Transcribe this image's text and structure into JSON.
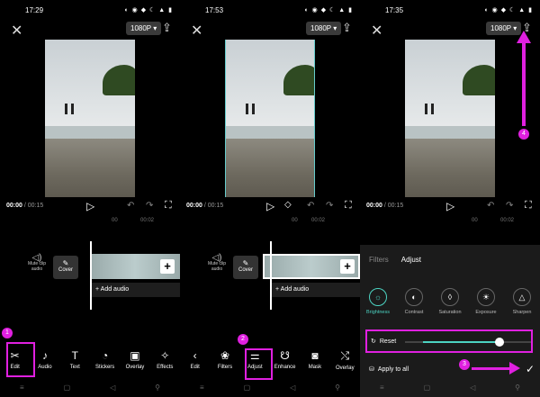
{
  "screens": [
    {
      "time": "17:29",
      "res": "1080P",
      "current": "00:00",
      "total": "00:15",
      "ruler": [
        "00",
        "00:02"
      ],
      "mute_label": "Mute clip audio",
      "cover_label": "Cover",
      "add_audio": "Add audio",
      "tools": [
        {
          "label": "Edit",
          "icon": "scissors-icon",
          "g": "✂"
        },
        {
          "label": "Audio",
          "icon": "music-note-icon",
          "g": "♪"
        },
        {
          "label": "Text",
          "icon": "text-icon",
          "g": "T"
        },
        {
          "label": "Stickers",
          "icon": "sticker-icon",
          "g": "◔"
        },
        {
          "label": "Overlay",
          "icon": "overlay-icon",
          "g": "▣"
        },
        {
          "label": "Effects",
          "icon": "sparkle-icon",
          "g": "✧"
        }
      ],
      "badge": "1"
    },
    {
      "time": "17:53",
      "res": "1080P",
      "current": "00:00",
      "total": "00:15",
      "ruler": [
        "00",
        "00:02"
      ],
      "mute_label": "Mute clip audio",
      "cover_label": "Cover",
      "add_audio": "Add audio",
      "tools": [
        {
          "label": "Edit",
          "icon": "back-chevron-icon",
          "g": "‹"
        },
        {
          "label": "Filters",
          "icon": "filters-icon",
          "g": "❀"
        },
        {
          "label": "Adjust",
          "icon": "sliders-icon",
          "g": "⚌"
        },
        {
          "label": "Enhance",
          "icon": "enhance-icon",
          "g": "☋"
        },
        {
          "label": "Mask",
          "icon": "mask-icon",
          "g": "◙"
        },
        {
          "label": "Overlay",
          "icon": "overlay-icon",
          "g": "⤭"
        }
      ],
      "badge": "2"
    },
    {
      "time": "17:35",
      "res": "1080P",
      "current": "00:00",
      "total": "00:15",
      "ruler": [
        "00",
        "00:02"
      ],
      "tabs": [
        "Filters",
        "Adjust"
      ],
      "adjust": [
        {
          "label": "Brightness",
          "g": "☼",
          "selected": true
        },
        {
          "label": "Contrast",
          "g": "◐"
        },
        {
          "label": "Saturation",
          "g": "◊"
        },
        {
          "label": "Exposure",
          "g": "☀"
        },
        {
          "label": "Sharpen",
          "g": "△"
        }
      ],
      "reset": "Reset",
      "slider_value_fraction": 0.85,
      "apply_all": "Apply to all",
      "badges": [
        "3",
        "4"
      ]
    }
  ],
  "highlight_color": "#e020e0",
  "accent": "#4cd3c2"
}
